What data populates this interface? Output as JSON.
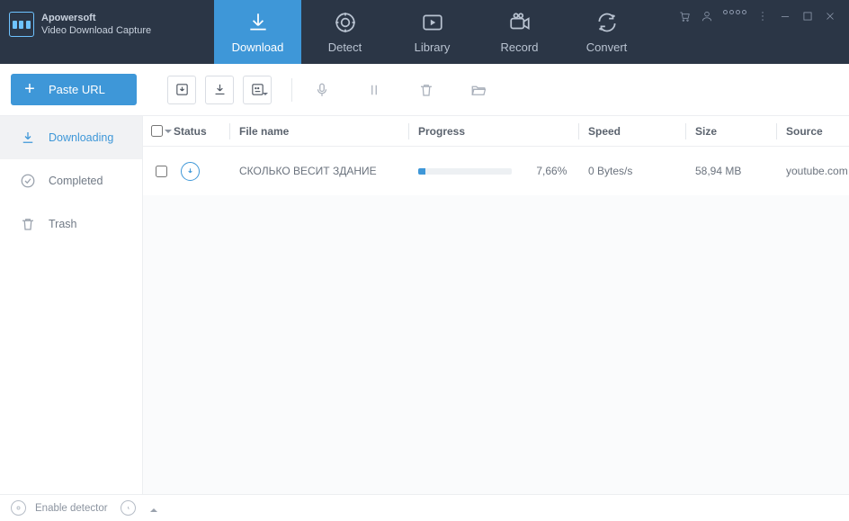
{
  "brand": {
    "line1": "Apowersoft",
    "line2": "Video Download Capture"
  },
  "nav": {
    "download": "Download",
    "detect": "Detect",
    "library": "Library",
    "record": "Record",
    "convert": "Convert"
  },
  "toolbar": {
    "paste_url": "Paste URL"
  },
  "sidebar": {
    "downloading": "Downloading",
    "completed": "Completed",
    "trash": "Trash"
  },
  "columns": {
    "status": "Status",
    "filename": "File name",
    "progress": "Progress",
    "speed": "Speed",
    "size": "Size",
    "source": "Source"
  },
  "rows": [
    {
      "filename": "СКОЛЬКО ВЕСИТ ЗДАНИЕ",
      "progress_pct": "7,66%",
      "progress_val": 7.66,
      "speed": "0 Bytes/s",
      "size": "58,94 MB",
      "source": "youtube.com"
    }
  ],
  "statusbar": {
    "detector": "Enable detector"
  }
}
